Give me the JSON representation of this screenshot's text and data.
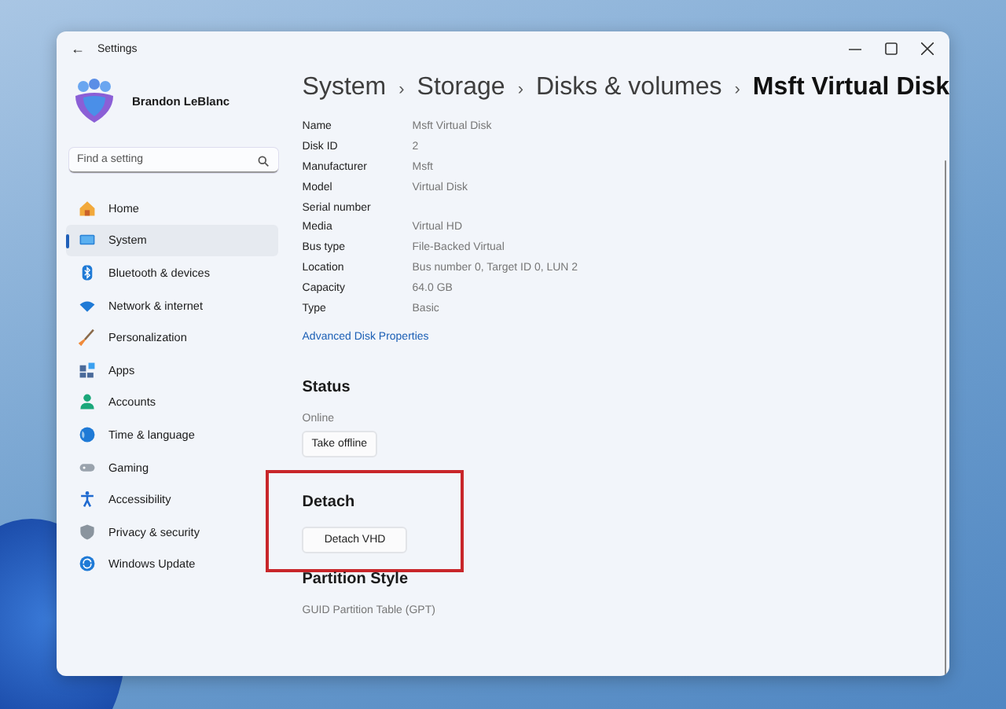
{
  "window": {
    "title": "Settings",
    "back": "←"
  },
  "profile": {
    "name": "Brandon LeBlanc"
  },
  "search": {
    "placeholder": "Find a setting"
  },
  "nav": [
    {
      "label": "Home",
      "kind": "home",
      "selected": false
    },
    {
      "label": "System",
      "kind": "system",
      "selected": true
    },
    {
      "label": "Bluetooth & devices",
      "kind": "bluetooth",
      "selected": false
    },
    {
      "label": "Network & internet",
      "kind": "network",
      "selected": false
    },
    {
      "label": "Personalization",
      "kind": "brush",
      "selected": false
    },
    {
      "label": "Apps",
      "kind": "apps",
      "selected": false
    },
    {
      "label": "Accounts",
      "kind": "person",
      "selected": false
    },
    {
      "label": "Time & language",
      "kind": "globe",
      "selected": false
    },
    {
      "label": "Gaming",
      "kind": "gamepad",
      "selected": false
    },
    {
      "label": "Accessibility",
      "kind": "accessibility",
      "selected": false
    },
    {
      "label": "Privacy & security",
      "kind": "shield",
      "selected": false
    },
    {
      "label": "Windows Update",
      "kind": "update",
      "selected": false
    }
  ],
  "breadcrumb": {
    "separator": "›",
    "items": [
      {
        "label": "System",
        "current": false
      },
      {
        "label": "Storage",
        "current": false
      },
      {
        "label": "Disks & volumes",
        "current": false
      },
      {
        "label": "Msft Virtual Disk",
        "current": true
      }
    ]
  },
  "properties": [
    {
      "label": "Name",
      "value": "Msft Virtual Disk"
    },
    {
      "label": "Disk ID",
      "value": "2"
    },
    {
      "label": "Manufacturer",
      "value": "Msft"
    },
    {
      "label": "Model",
      "value": "Virtual Disk"
    },
    {
      "label": "Serial number"
    },
    {
      "label": "Media",
      "value": "Virtual HD"
    },
    {
      "label": "Bus type",
      "value": "File-Backed Virtual"
    },
    {
      "label": "Location",
      "value": "Bus number 0, Target ID 0, LUN 2"
    },
    {
      "label": "Capacity",
      "value": "64.0 GB"
    },
    {
      "label": "Type",
      "value": "Basic"
    }
  ],
  "link": "Advanced Disk Properties",
  "sections": [
    {
      "heading": "Status",
      "caption": "Online",
      "button": "Take offline",
      "highlighted": false
    },
    {
      "heading": "Detach",
      "button": "Detach VHD",
      "highlighted": true
    },
    {
      "heading": "Partition Style",
      "caption": "GUID Partition Table (GPT)",
      "highlighted": false
    }
  ]
}
